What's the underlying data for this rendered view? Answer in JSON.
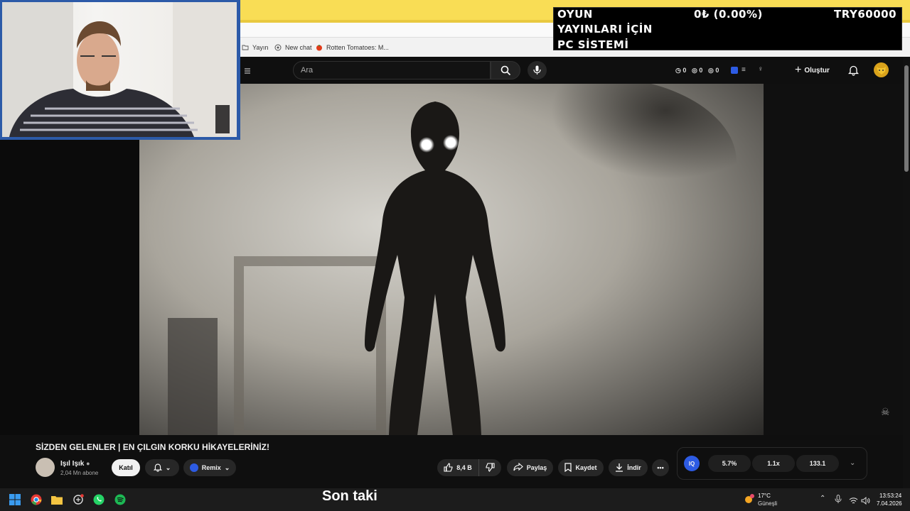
{
  "overlay": {
    "line1": "OYUN",
    "line2": "YAYINLARI İÇİN",
    "line3": "PC SİSTEMİ",
    "amount": "0₺ (0.00%)",
    "goal": "TRY60000"
  },
  "bookmarks": [
    {
      "label": "Yayın",
      "icon": "folder-icon"
    },
    {
      "label": "New chat",
      "icon": "chatgpt-icon"
    },
    {
      "label": "Rotten Tomatoes: M...",
      "icon": "tomato-icon"
    }
  ],
  "header": {
    "search_placeholder": "Ara",
    "stats": [
      "0",
      "0",
      "0"
    ],
    "create_label": "Oluştur"
  },
  "video": {
    "title": "SİZDEN GELENLER | EN ÇILGIN KORKU HİKAYELERİNİZ!",
    "channel": "Işıl Işık",
    "subscribers": "2,04 Mn abone",
    "join_label": "Katıl",
    "remix_label": "Remix",
    "likes": "8,4 B",
    "share_label": "Paylaş",
    "save_label": "Kaydet",
    "download_label": "İndir"
  },
  "iq_panel": {
    "badge": "IQ",
    "values": [
      "5.7%",
      "1.1x",
      "133.1"
    ]
  },
  "taskbar": {
    "subtitle": "Son taki",
    "temperature": "17°C",
    "weather": "Güneşli",
    "time": "13:53:24",
    "date": "7.04.2026"
  },
  "colors": {
    "overlay_bg": "#000000",
    "yellow": "#f9dd55",
    "webcam_border": "#2c5aa8"
  }
}
